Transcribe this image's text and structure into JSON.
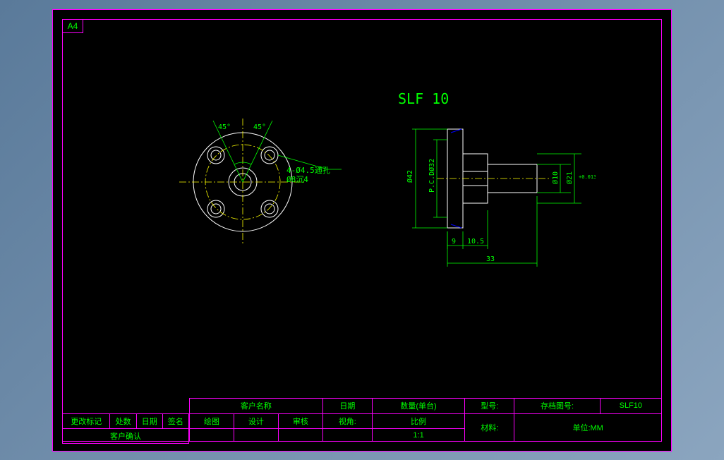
{
  "sheet": {
    "format": "A4"
  },
  "part": {
    "title": "SLF 10"
  },
  "dimensions": {
    "front": {
      "angle1": "45°",
      "angle2": "45°",
      "holes": "4-Ø4.5通孔",
      "cbore": "Ø8沉4"
    },
    "side": {
      "d42": "Ø42",
      "pcd": "P.C.DØ32",
      "d10": "Ø10",
      "d21": "Ø21",
      "tol": "+0.013/-0.013",
      "l9": "9",
      "l10_5": "10.5",
      "l33": "33"
    }
  },
  "titleblock": {
    "left": {
      "l1": "更改标记",
      "l2": "处数",
      "l3": "日期",
      "l4": "签名",
      "l5": "客户确认"
    },
    "headers": {
      "cust": "客户名称",
      "date": "日期",
      "qty": "数量(单台)",
      "model": "型号:",
      "archive": "存档图号:",
      "archive_val": "SLF10",
      "draw": "绘图",
      "design": "设计",
      "check": "审核",
      "view": "视角:",
      "scale": "比例",
      "scale_val": "1:1",
      "material": "材料:",
      "unit": "单位:MM"
    }
  }
}
